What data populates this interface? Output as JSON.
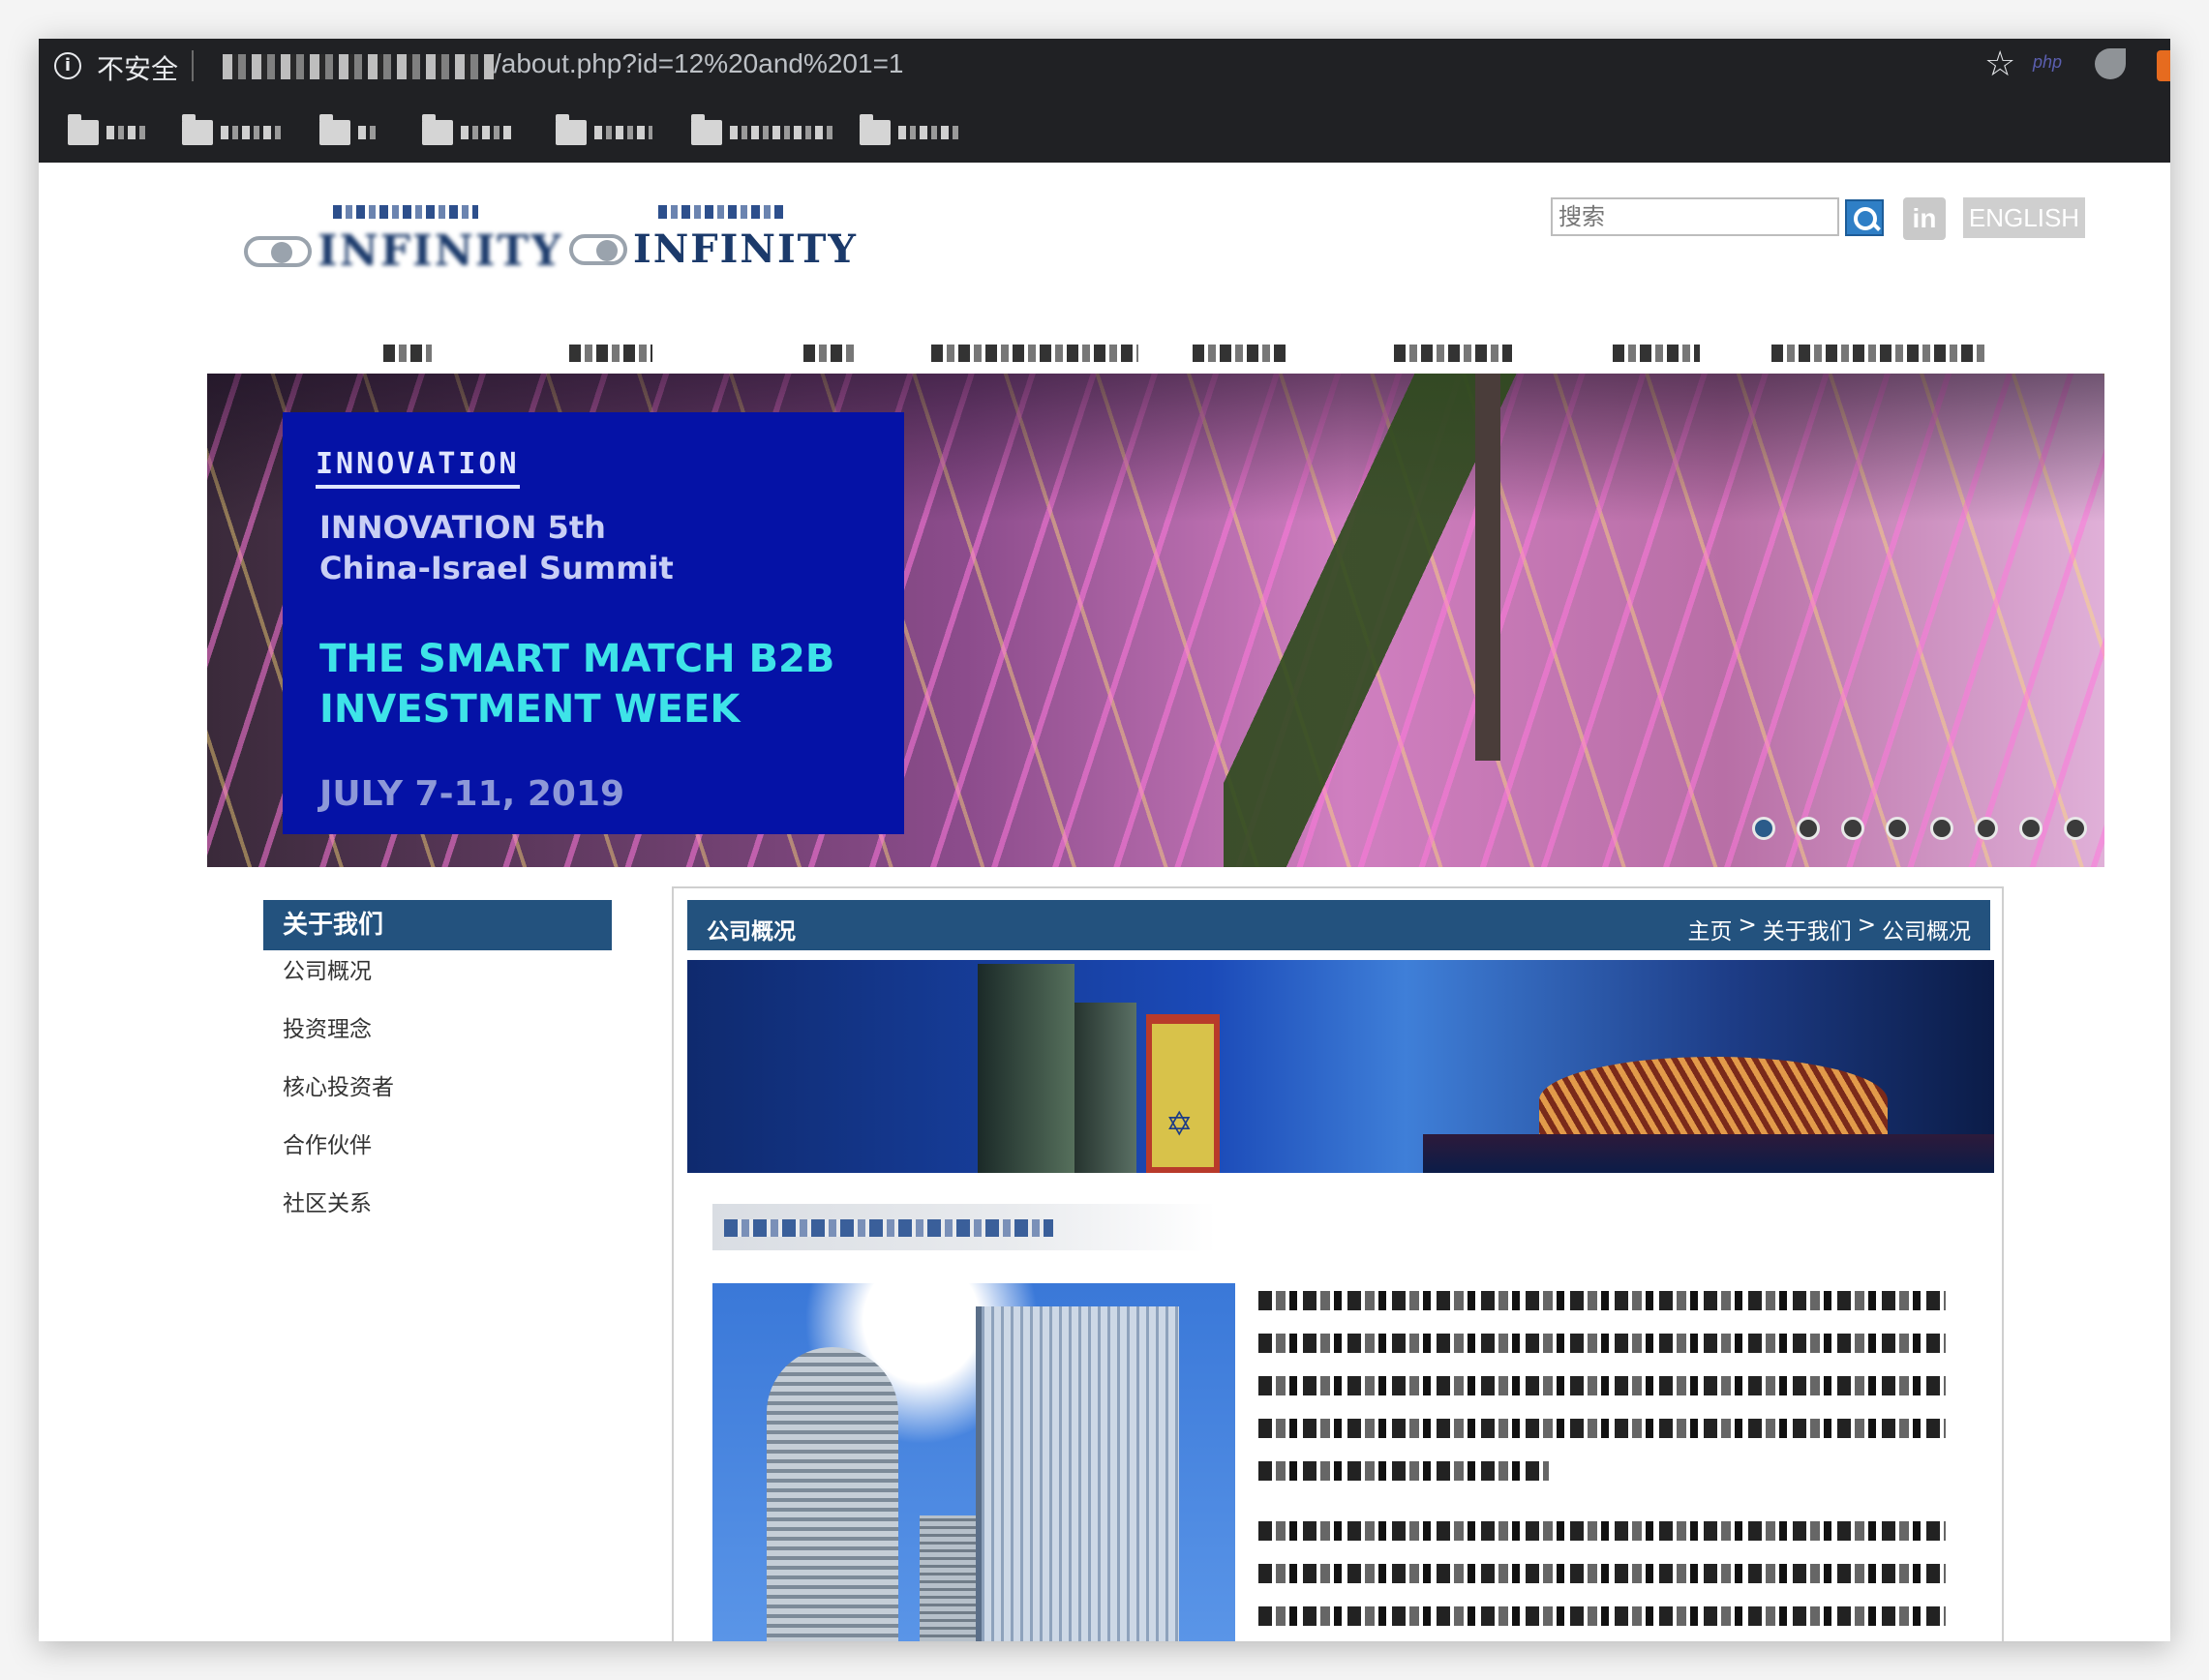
{
  "browser": {
    "security_label": "不安全",
    "url_path": "/about.php?id=12%20and%201=1",
    "icons": [
      "info-icon",
      "star-icon",
      "php-extension-icon",
      "leaf-extension-icon",
      "fox-extension-icon",
      "folder-icon"
    ]
  },
  "header": {
    "search_placeholder": "搜索",
    "linkedin_label": "in",
    "english_label": "ENGLISH"
  },
  "banner": {
    "tag": "INNOVATION",
    "line1": "INNOVATION 5th",
    "line2": "China-Israel Summit",
    "line3": "THE SMART MATCH B2B",
    "line4": "INVESTMENT WEEK",
    "line5": "JULY 7-11, 2019",
    "slide_count": 8,
    "active_slide": 1
  },
  "sidebar": {
    "title": "关于我们",
    "items": [
      {
        "label": "公司概况"
      },
      {
        "label": "投资理念"
      },
      {
        "label": "核心投资者"
      },
      {
        "label": "合作伙伴"
      },
      {
        "label": "社区关系"
      }
    ]
  },
  "main": {
    "title": "公司概况",
    "breadcrumb": {
      "home": "主页",
      "sep1": ">",
      "section": "关于我们",
      "sep2": ">",
      "current": "公司概况"
    }
  },
  "colors": {
    "chrome_bg": "#202124",
    "section_header": "#23527e",
    "banner_box": "#0512a6",
    "banner_highlight": "#3ee3e8",
    "search_button": "#2f7fc6"
  }
}
